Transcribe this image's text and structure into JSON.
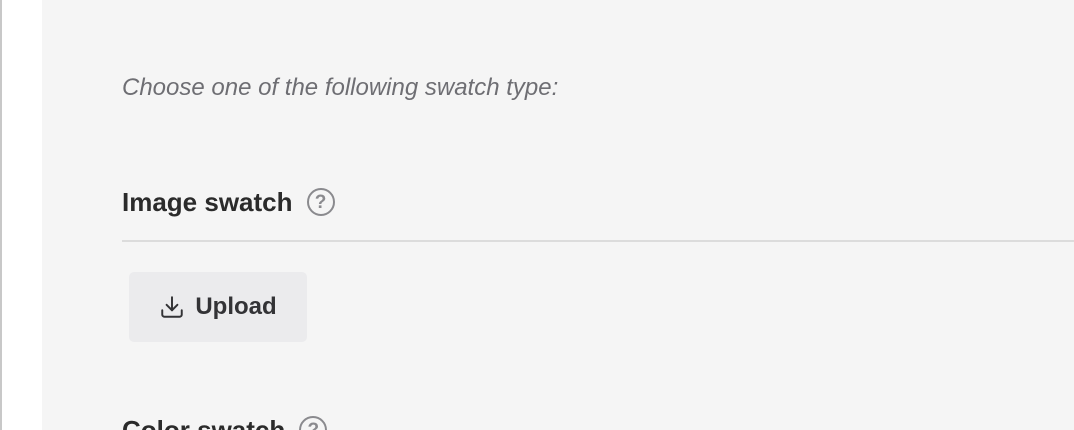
{
  "panel": {
    "intro_text": "Choose one of the following swatch type:",
    "sections": [
      {
        "title": "Image swatch",
        "help_glyph": "?",
        "help_icon": "question-circle-icon",
        "upload": {
          "label": "Upload",
          "icon": "download-arrow-icon"
        }
      },
      {
        "title": "Color swatch",
        "help_glyph": "?",
        "help_icon": "question-circle-icon"
      }
    ]
  },
  "colors": {
    "panel_background": "#f5f5f5",
    "button_background": "#ebebed",
    "heading_text": "#2b2b2b",
    "muted_text": "#6e6e73",
    "divider": "#dcdcdc"
  }
}
